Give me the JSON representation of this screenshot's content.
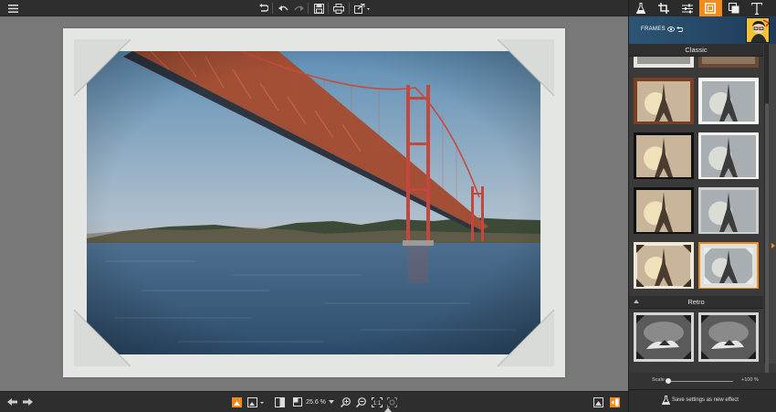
{
  "toolbar": {
    "icons": [
      "menu-icon",
      "rotate-left-icon",
      "undo-icon",
      "redo-icon",
      "save-icon",
      "print-icon",
      "export-icon"
    ]
  },
  "bottombar": {
    "zoom_value": "25.6 %",
    "icons": [
      "arrow-left-icon",
      "arrow-right-icon",
      "fit-view-icon",
      "image-view-icon",
      "compare-icon",
      "zoom-in-icon",
      "zoom-out-icon",
      "actual-size-icon",
      "fit-screen-icon",
      "snapshot-icon",
      "panel-toggle-icon"
    ]
  },
  "panel": {
    "tabs": [
      "flask-icon",
      "crop-icon",
      "sliders-icon",
      "frames-icon",
      "layers-icon",
      "text-icon"
    ],
    "active_tab": "frames-icon",
    "header_title": "FRAMES",
    "sections": [
      {
        "label": "Classic"
      },
      {
        "label": "Retro"
      }
    ],
    "scale_label": "Scale",
    "scale_value": "+100 %",
    "save_label": "Save settings as new effect"
  },
  "colors": {
    "accent": "#f08c1c",
    "toolbar_bg": "#2e2e2e",
    "panel_bg": "#3a3a3a",
    "canvas_bg": "#787878",
    "frame_bg": "#e3e6e2"
  }
}
